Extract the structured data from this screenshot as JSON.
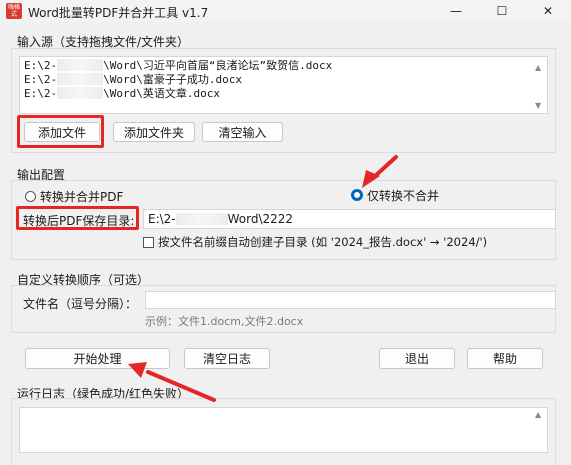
{
  "titlebar": {
    "title": "Word批量转PDF并合并工具 v1.7",
    "icon_text": "嗨格\n式",
    "minimize": "—",
    "maximize": "☐",
    "close": "✕"
  },
  "input_group": {
    "title": "输入源（支持拖拽文件/文件夹）",
    "files": [
      {
        "prefix": "E:\\2-",
        "suffix": "\\Word\\习近平向首届“良渚论坛”致贺信.docx"
      },
      {
        "prefix": "E:\\2-",
        "suffix": "\\Word\\富豪子子成功.docx"
      },
      {
        "prefix": "E:\\2-",
        "suffix": "\\Word\\英语文章.docx"
      }
    ],
    "add_file": "添加文件",
    "add_folder": "添加文件夹",
    "clear_input": "清空输入"
  },
  "output_group": {
    "title": "输出配置",
    "radio_merge": "转换并合并PDF",
    "radio_convert_only": "仅转换不合并",
    "selected": "convert_only",
    "save_dir_label": "转换后PDF保存目录:",
    "save_dir_prefix": "E:\\2-",
    "save_dir_suffix": "Word\\2222",
    "subdir_checkbox": "按文件名前缀自动创建子目录 (如 '2024_报告.docx' → '2024/')",
    "subdir_checked": false
  },
  "order_group": {
    "title": "自定义转换顺序（可选）",
    "filename_label": "文件名（逗号分隔）：",
    "filename_value": "",
    "example": "示例：文件1.docm,文件2.docx"
  },
  "actions": {
    "start": "开始处理",
    "clear_log": "清空日志",
    "exit": "退出",
    "help": "帮助"
  },
  "log_group": {
    "title": "运行日志（绿色成功/红色失败）"
  },
  "colors": {
    "highlight_red": "#e52626",
    "radio_blue": "#0067c0"
  }
}
